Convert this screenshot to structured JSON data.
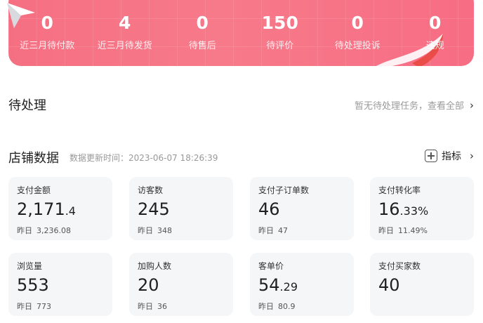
{
  "banner": {
    "stats": [
      {
        "value": "0",
        "label": "近三月待付款"
      },
      {
        "value": "4",
        "label": "近三月待发货"
      },
      {
        "value": "0",
        "label": "待售后"
      },
      {
        "value": "150",
        "label": "待评价"
      },
      {
        "value": "0",
        "label": "待处理投诉"
      },
      {
        "value": "0",
        "label": "违规"
      }
    ]
  },
  "todo": {
    "title": "待处理",
    "link": "暂无待处理任务，查看全部"
  },
  "shop": {
    "title": "店铺数据",
    "updated_label": "数据更新时间：2023-06-07 18:26:39",
    "metric_button": "指标"
  },
  "cards": [
    {
      "label": "支付金额",
      "int": "2,171",
      "dec": ".4",
      "prev_label": "昨日",
      "prev_value": "3,236.08"
    },
    {
      "label": "访客数",
      "int": "245",
      "dec": "",
      "prev_label": "昨日",
      "prev_value": "348"
    },
    {
      "label": "支付子订单数",
      "int": "46",
      "dec": "",
      "prev_label": "昨日",
      "prev_value": "47"
    },
    {
      "label": "支付转化率",
      "int": "16",
      "dec": ".33%",
      "prev_label": "昨日",
      "prev_value": "11.49%"
    },
    {
      "label": "浏览量",
      "int": "553",
      "dec": "",
      "prev_label": "昨日",
      "prev_value": "773"
    },
    {
      "label": "加购人数",
      "int": "20",
      "dec": "",
      "prev_label": "昨日",
      "prev_value": "36"
    },
    {
      "label": "客单价",
      "int": "54",
      "dec": ".29",
      "prev_label": "昨日",
      "prev_value": "80.9"
    },
    {
      "label": "支付买家数",
      "int": "40",
      "dec": "",
      "prev_label": "",
      "prev_value": ""
    }
  ],
  "colors": {
    "banner_start": "#f56f82",
    "banner_end": "#f76d84",
    "card_bg": "#f5f6f8"
  },
  "icons": [
    "star-logo-icon",
    "chevron-right-icon",
    "plus-square-icon"
  ]
}
